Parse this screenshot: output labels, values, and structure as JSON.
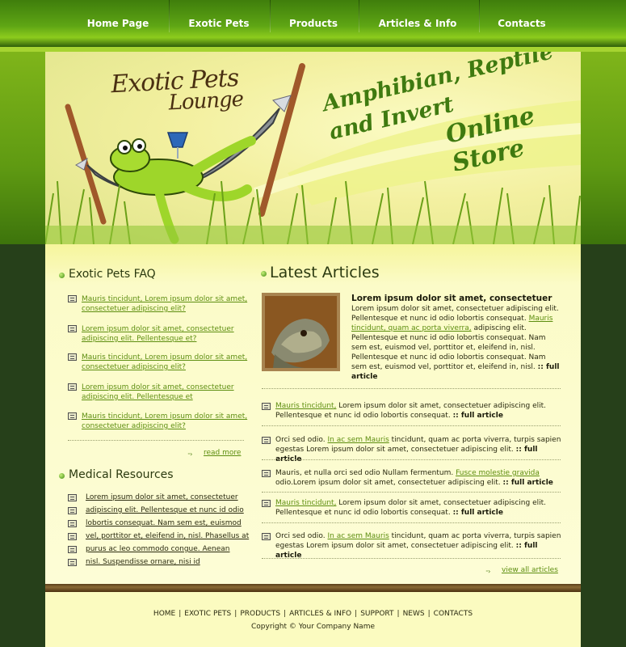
{
  "nav": {
    "items": [
      "Home Page",
      "Exotic Pets",
      "Products",
      "Articles & Info",
      "Contacts"
    ]
  },
  "header": {
    "logo_line1": "Exotic Pets",
    "logo_line2": "Lounge",
    "tagline_line1": "Amphibian, Reptile and Invert",
    "tagline_line2": "Online Store"
  },
  "faq": {
    "title": "Exotic Pets FAQ",
    "items": [
      "Mauris tincidunt, Lorem ipsum dolor sit amet, consectetuer adipiscing elit?",
      "Lorem ipsum dolor sit amet, consectetuer adipiscing elit. Pellentesque et?",
      "Mauris tincidunt, Lorem ipsum dolor sit amet, consectetuer adipiscing elit?",
      "Lorem ipsum dolor sit amet, consectetuer adipiscing elit. Pellentesque et",
      "Mauris tincidunt, Lorem ipsum dolor sit amet, consectetuer adipiscing elit?"
    ],
    "more_label": "read more"
  },
  "medical": {
    "title": "Medical Resources",
    "items": [
      "Lorem ipsum dolor sit amet, consectetuer",
      "adipiscing elit. Pellentesque et nunc id odio",
      "lobortis consequat. Nam sem est, euismod",
      "vel, porttitor et, eleifend in, nisl. Phasellus at",
      "purus ac leo commodo congue. Aenean",
      "nisl. Suspendisse ornare, nisi id"
    ]
  },
  "articles": {
    "title": "Latest Articles",
    "featured": {
      "heading": "Lorem ipsum dolor sit amet, consectetuer",
      "text1": "Lorem ipsum dolor sit amet, consectetuer adipiscing elit. Pellentesque et nunc id odio lobortis consequat.",
      "link": "Mauris tincidunt, quam ac porta viverra,",
      "text2": " adipiscing elit. Pellentesque et nunc id odio lobortis consequat. Nam sem est, euismod vel, porttitor et, eleifend in, nisl. Pellentesque et nunc id odio lobortis consequat. Nam sem est, euismod vel, porttitor et, eleifend in, nisl.",
      "full": ":: full article"
    },
    "list": [
      {
        "pre": "",
        "link": "Mauris tincidunt,",
        "post": " Lorem ipsum dolor sit amet, consectetuer adipiscing elit. Pellentesque et nunc id odio lobortis consequat.",
        "full": ":: full article"
      },
      {
        "pre": "Orci sed odio. ",
        "link": "In ac sem Mauris",
        "post": " tincidunt, quam ac porta viverra, turpis sapien egestas Lorem ipsum dolor sit amet, consectetuer adipiscing elit.",
        "full": ":: full article"
      },
      {
        "pre": "Mauris, et nulla orci sed odio Nullam fermentum. ",
        "link": "Fusce molestie gravida",
        "post": " odio.Lorem ipsum dolor sit amet, consectetuer adipiscing elit.",
        "full": ":: full article"
      },
      {
        "pre": "",
        "link": "Mauris tincidunt,",
        "post": " Lorem ipsum dolor sit amet, consectetuer adipiscing elit. Pellentesque et nunc id odio lobortis consequat.",
        "full": ":: full article"
      },
      {
        "pre": "Orci sed odio. ",
        "link": "In ac sem Mauris",
        "post": " tincidunt, quam ac porta viverra, turpis sapien egestas Lorem ipsum dolor sit amet, consectetuer adipiscing elit.",
        "full": ":: full article"
      }
    ],
    "view_all_label": "view all articles"
  },
  "footer": {
    "links": [
      "HOME",
      "EXOTIC PETS",
      "PRODUCTS",
      "ARTICLES & INFO",
      "SUPPORT",
      "NEWS",
      "CONTACTS"
    ],
    "separator": "|",
    "copyright": "Copyright © Your Company Name"
  },
  "colors": {
    "nav_green": "#5ea514",
    "link_green": "#5d8e10",
    "cream": "#fbfbc8",
    "dark_green": "#26401a",
    "brown": "#8a6a35"
  }
}
